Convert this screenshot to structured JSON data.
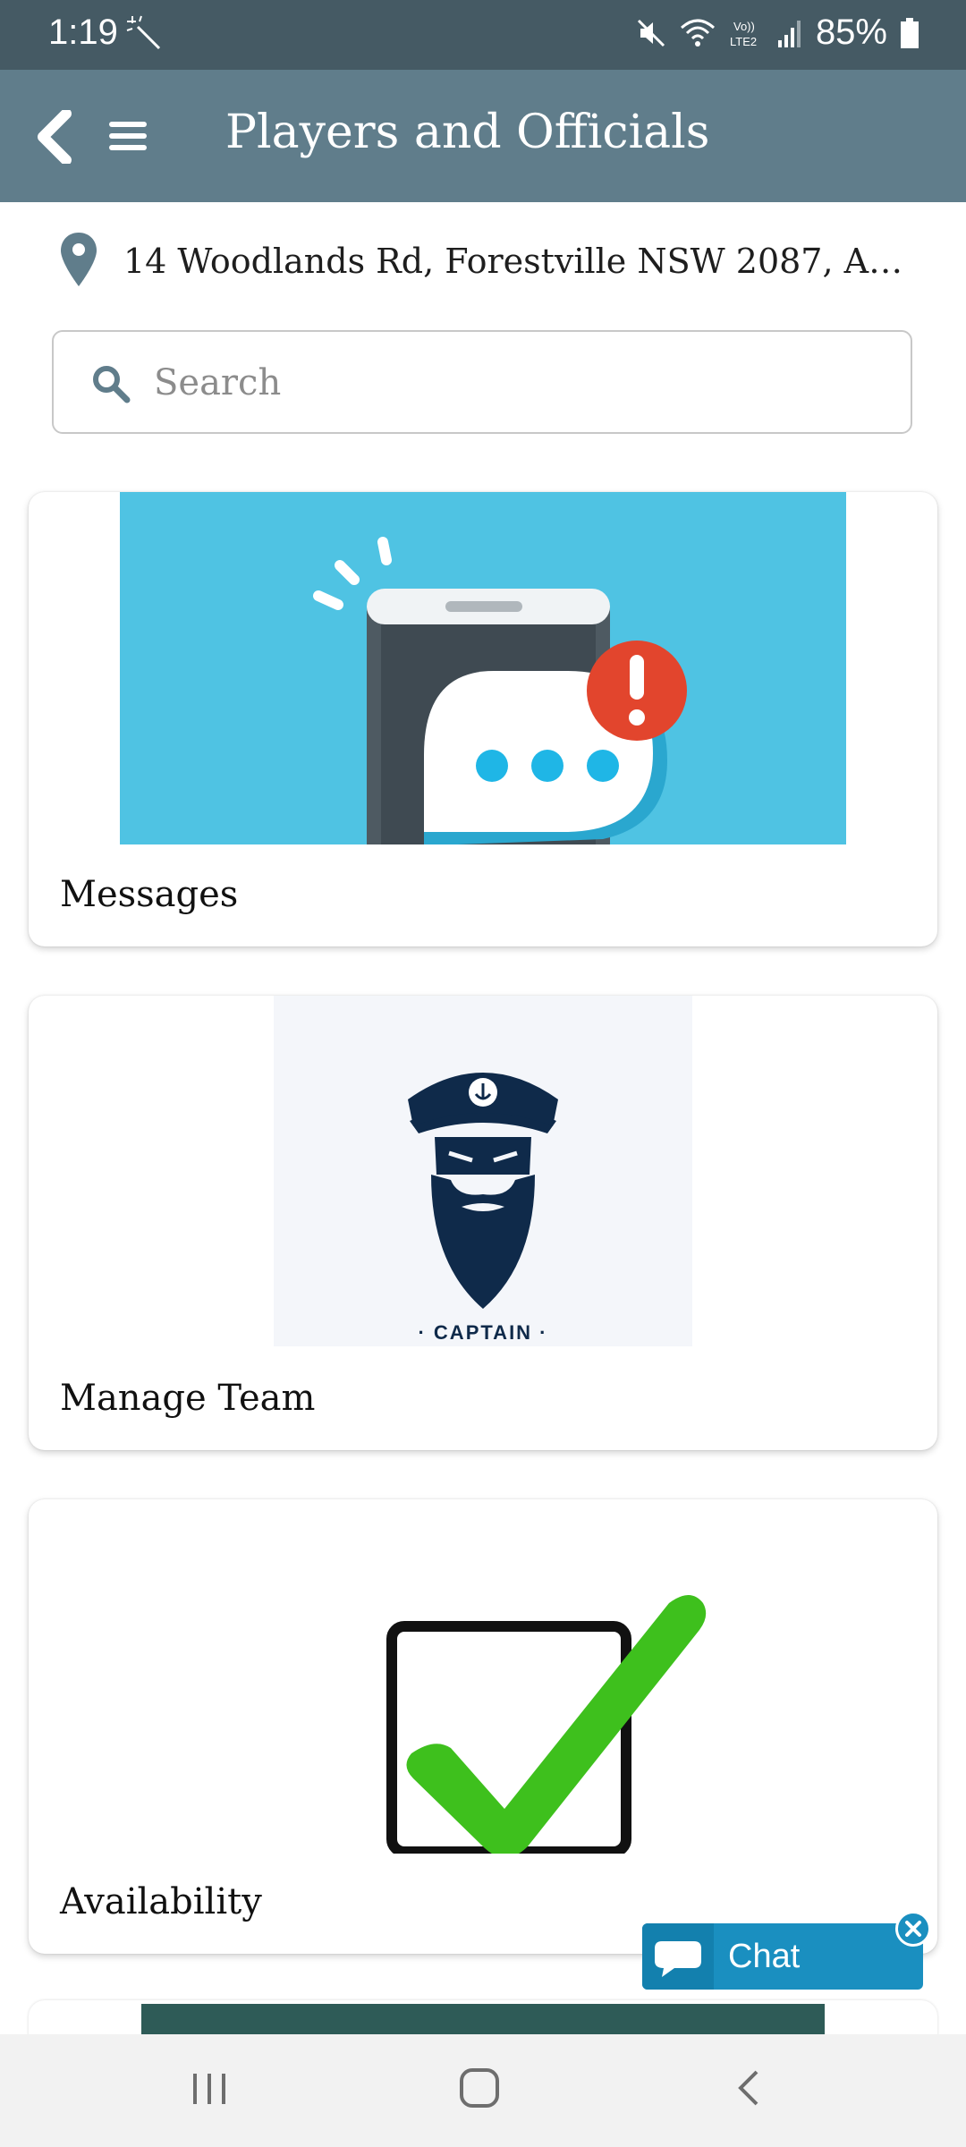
{
  "status_bar": {
    "time": "1:19",
    "battery": "85%",
    "icons": [
      "magic-wand-icon",
      "mute-icon",
      "wifi-icon",
      "volte-lte2-icon",
      "signal-icon",
      "battery-icon"
    ]
  },
  "app_bar": {
    "title": "Players and Officials",
    "back_icon": "chevron-left-icon",
    "menu_icon": "hamburger-menu-icon",
    "background": "#607d8b"
  },
  "location": {
    "text": "14 Woodlands Rd, Forestville NSW 2087, Austr..."
  },
  "search": {
    "placeholder": "Search",
    "value": ""
  },
  "cards": [
    {
      "label": "Messages",
      "image": "phone-message-alert-illustration"
    },
    {
      "label": "Manage Team",
      "image": "captain-logo",
      "image_text": "· CAPTAIN ·"
    },
    {
      "label": "Availability",
      "image": "green-checkbox-illustration"
    }
  ],
  "chat": {
    "label": "Chat",
    "color": "#1a8fc0"
  },
  "nav_bar": {
    "buttons": [
      "recent-apps-icon",
      "home-icon",
      "back-icon"
    ]
  }
}
